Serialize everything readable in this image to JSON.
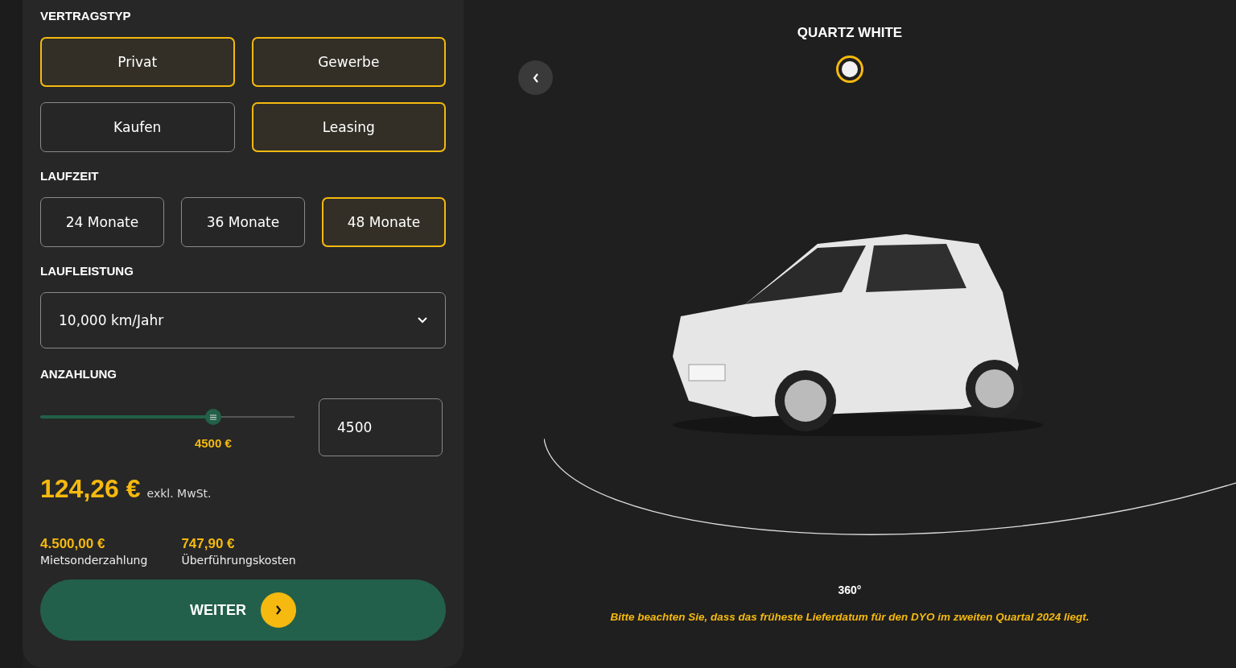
{
  "contract_type": {
    "title": "VERTRAGSTYP",
    "options": [
      {
        "label": "Privat",
        "selected": true
      },
      {
        "label": "Gewerbe",
        "selected": true
      },
      {
        "label": "Kaufen",
        "selected": false
      },
      {
        "label": "Leasing",
        "selected": true
      }
    ]
  },
  "term": {
    "title": "LAUFZEIT",
    "options": [
      {
        "label": "24 Monate",
        "selected": false
      },
      {
        "label": "36 Monate",
        "selected": false
      },
      {
        "label": "48 Monate",
        "selected": true
      }
    ]
  },
  "mileage": {
    "title": "LAUFLEISTUNG",
    "value": "10,000 km/Jahr"
  },
  "down_payment": {
    "title": "ANZAHLUNG",
    "level": 0.68,
    "reading": "4500 €",
    "value": "4500"
  },
  "price": {
    "amount": "124,26 €",
    "note": "exkl. MwSt."
  },
  "costs": [
    {
      "amount": "4.500,00 €",
      "label": "Mietsonderzahlung"
    },
    {
      "amount": "747,90 €",
      "label": "Überführungskosten"
    }
  ],
  "next_button": {
    "label": "WEITER"
  },
  "color_picker": {
    "title": "QUARTZ WHITE",
    "swatches": [
      {
        "color": "#f2f2f2",
        "selected": true
      }
    ]
  },
  "view_label": "360°",
  "notice": "Bitte beachten Sie, dass das früheste Lieferdatum für den DYO im zweiten Quartal 2024 liegt."
}
